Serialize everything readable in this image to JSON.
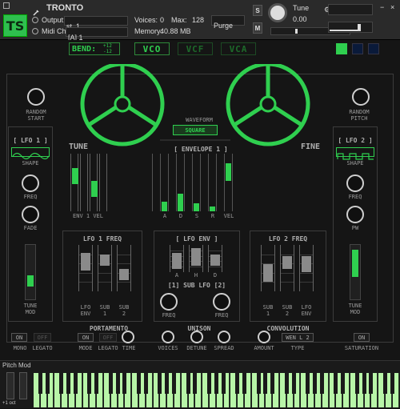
{
  "header": {
    "instrument_name": "TRONTO",
    "logo_text": "TS",
    "output_label": "Output:",
    "output_value": "st. 1",
    "midi_label": "Midi Ch:",
    "midi_value": "[A] 1",
    "voices_label": "Voices:",
    "voices_value": "0",
    "max_label": "Max:",
    "max_value": "128",
    "purge_label": "Purge",
    "memory_label": "Memory:",
    "memory_value": "40.88 MB",
    "solo_label": "S",
    "mute_label": "M",
    "tune_label": "Tune",
    "tune_value": "0.00"
  },
  "top_tabs": {
    "bend_label": "BEND:",
    "bend_up": "+12",
    "bend_down": "-12",
    "vco": "VCO",
    "vcf": "VCF",
    "vca": "VCA"
  },
  "color_swatches": [
    "#2fcf4f",
    "#0a1a3a",
    "#0a1a3a"
  ],
  "random_start": [
    "RANDOM",
    "START"
  ],
  "random_pitch": [
    "RANDOM",
    "PITCH"
  ],
  "waveform": {
    "label": "WAVEFORM",
    "value": "SQUARE"
  },
  "tune_label": "TUNE",
  "fine_label": "FINE",
  "envelope": {
    "title": "ENVELOPE 1",
    "labels": [
      "A",
      "D",
      "S",
      "R",
      "VEL"
    ],
    "values": [
      0.3,
      0.55,
      0.25,
      0.15,
      0.65
    ]
  },
  "tune_steps": {
    "labels": [
      "ENV",
      "1",
      "VEL"
    ],
    "values": [
      0.65,
      0.35
    ]
  },
  "lfo1": {
    "title": "[ LFO 1 ]",
    "shape_label": "SHAPE",
    "freq_label": "FREQ",
    "fade_label": "FADE",
    "tune_mod": [
      "TUNE",
      "MOD"
    ],
    "tune_mod_level": 0.3
  },
  "lfo2": {
    "title": "[ LFO 2 ]",
    "shape_label": "SHAPE",
    "freq_label": "FREQ",
    "pw_label": "PW",
    "tune_mod": [
      "TUNE",
      "MOD"
    ],
    "tune_mod_level": 0.5
  },
  "lfo1_freq": {
    "title": "LFO 1 FREQ",
    "labels": [
      [
        "LFO",
        "ENV"
      ],
      [
        "SUB",
        "1"
      ],
      [
        "SUB",
        "2"
      ]
    ]
  },
  "lfo_env": {
    "title": "[ LFO ENV ]",
    "labels": [
      "A",
      "H",
      "D"
    ]
  },
  "lfo2_freq": {
    "title": "LFO 2 FREQ",
    "labels": [
      [
        "SUB",
        "1"
      ],
      [
        "SUB",
        "2"
      ],
      [
        "LFO",
        "ENV"
      ]
    ]
  },
  "sub_lfo": {
    "title": "[1] SUB LFO [2]",
    "freq_label": "FREQ"
  },
  "bottom": {
    "mono_on": "ON",
    "mono_label": "MONO",
    "legato_off": "OFF",
    "legato_label": "LEGATO",
    "portamento": "PORTAMENTO",
    "mode_on": "ON",
    "mode_label": "MODE",
    "port_legato_off": "OFF",
    "port_legato_label": "LEGATO",
    "time_label": "TIME",
    "unison": "UNISON",
    "voices_label": "VOICES",
    "detune_label": "DETUNE",
    "spread_label": "SPREAD",
    "convolution": "CONVOLUTION",
    "amount_label": "AMOUNT",
    "type_value": "WEN L 2",
    "type_label": "TYPE",
    "sat_on": "ON",
    "saturation_label": "SATURATION"
  },
  "keyboard": {
    "pitch_mod_label": "Pitch Mod",
    "octave_label": "+1 oct"
  }
}
